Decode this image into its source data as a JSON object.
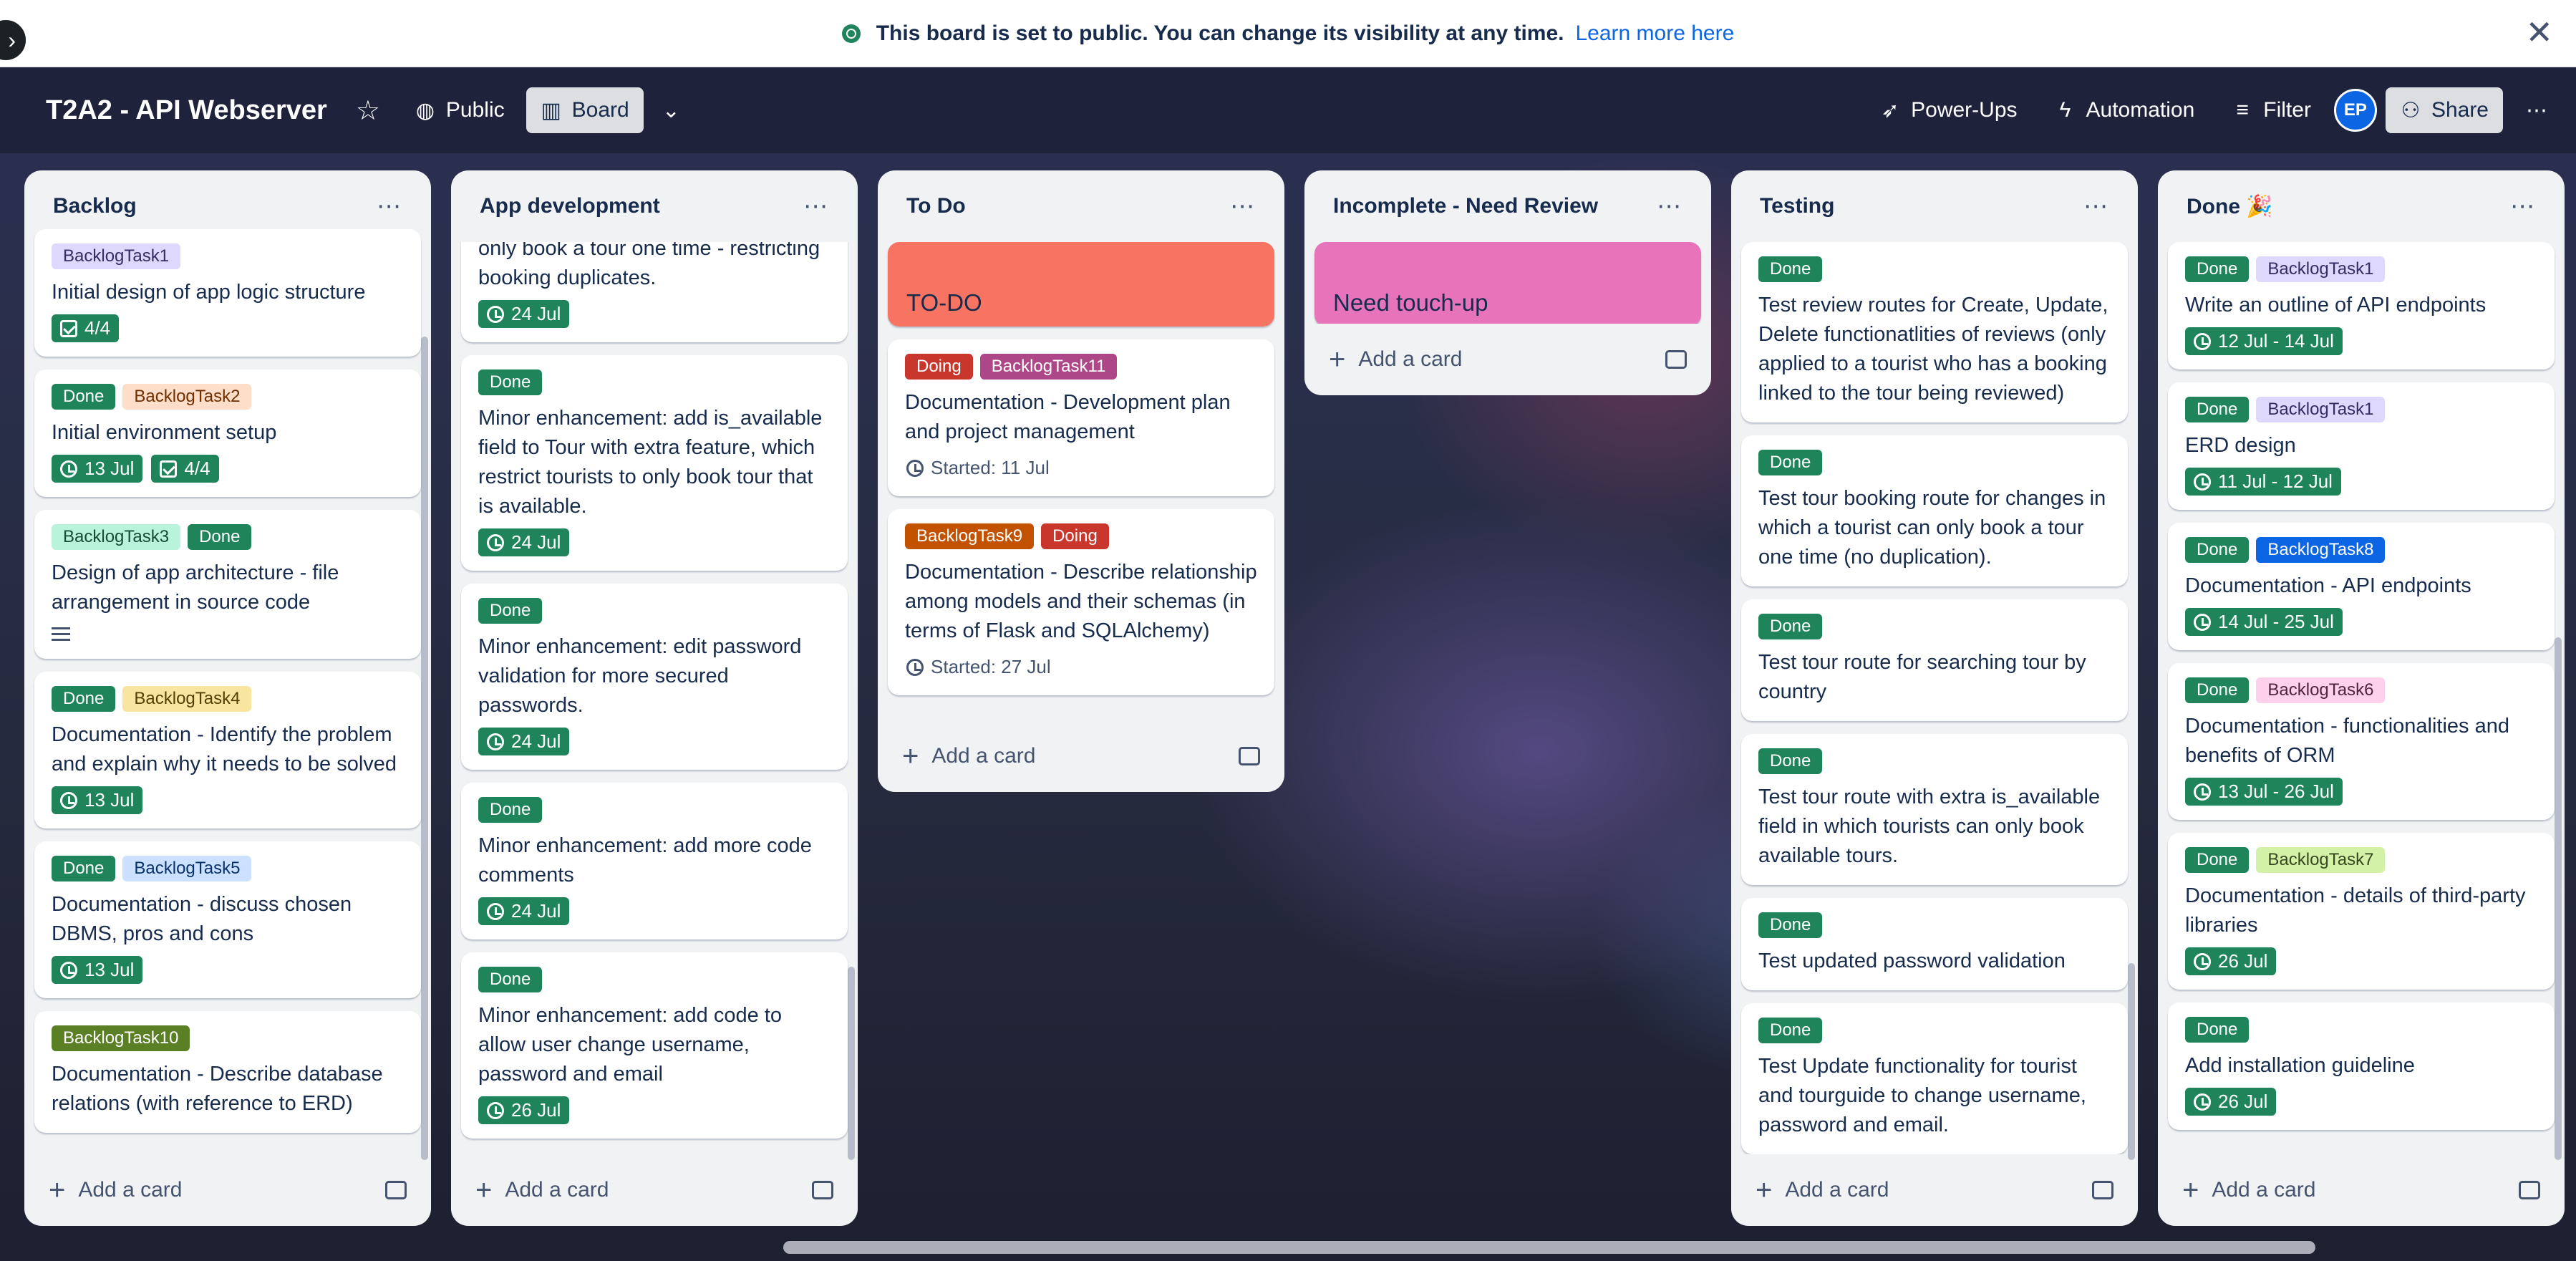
{
  "banner": {
    "message": "This board is set to public. You can change its visibility at any time.",
    "link": "Learn more here"
  },
  "board": {
    "title": "T2A2 - API Webserver",
    "visibility": "Public",
    "view": "Board",
    "power_ups": "Power-Ups",
    "automation": "Automation",
    "filter": "Filter",
    "avatar_initials": "EP",
    "share": "Share"
  },
  "lists": [
    {
      "title": "Backlog",
      "add_card": "Add a card",
      "cards": [
        {
          "labels": [
            {
              "text": "BacklogTask1",
              "bg": "#dfd8fd",
              "fg": "#352c63"
            }
          ],
          "title": "Initial design of app logic structure",
          "badges": [
            {
              "type": "check",
              "text": "4/4"
            }
          ]
        },
        {
          "labels": [
            {
              "text": "Done",
              "bg": "#1f845a",
              "fg": "#ffffff"
            },
            {
              "text": "BacklogTask2",
              "bg": "#fedec8",
              "fg": "#702e00"
            }
          ],
          "title": "Initial environment setup",
          "badges": [
            {
              "type": "date",
              "text": "13 Jul"
            },
            {
              "type": "check",
              "text": "4/4"
            }
          ]
        },
        {
          "labels": [
            {
              "text": "BacklogTask3",
              "bg": "#baf3db",
              "fg": "#164b35"
            },
            {
              "text": "Done",
              "bg": "#1f845a",
              "fg": "#ffffff"
            }
          ],
          "title": "Design of app architecture - file arrangement in source code",
          "description": true,
          "badges": []
        },
        {
          "labels": [
            {
              "text": "Done",
              "bg": "#1f845a",
              "fg": "#ffffff"
            },
            {
              "text": "BacklogTask4",
              "bg": "#f8e6a0",
              "fg": "#533f04"
            }
          ],
          "title": "Documentation - Identify the problem and explain why it needs to be solved",
          "badges": [
            {
              "type": "date",
              "text": "13 Jul"
            }
          ]
        },
        {
          "labels": [
            {
              "text": "Done",
              "bg": "#1f845a",
              "fg": "#ffffff"
            },
            {
              "text": "BacklogTask5",
              "bg": "#cce0ff",
              "fg": "#09326c"
            }
          ],
          "title": "Documentation - discuss chosen DBMS, pros and cons",
          "badges": [
            {
              "type": "date",
              "text": "13 Jul"
            }
          ]
        },
        {
          "labels": [
            {
              "text": "BacklogTask10",
              "bg": "#5b7f24",
              "fg": "#ffffff"
            }
          ],
          "title": "Documentation - Describe database relations (with reference to ERD)",
          "badges": []
        }
      ]
    },
    {
      "title": "App development",
      "add_card": "Add a card",
      "cards": [
        {
          "partial": true,
          "labels": [],
          "title": "Minor enhancement: one tourist can only book a tour one time - restricting booking duplicates.",
          "badges": [
            {
              "type": "date",
              "text": "24 Jul"
            }
          ]
        },
        {
          "labels": [
            {
              "text": "Done",
              "bg": "#1f845a",
              "fg": "#ffffff"
            }
          ],
          "title": "Minor enhancement: add is_available field to Tour with extra feature, which restrict tourists to only book tour that is available.",
          "badges": [
            {
              "type": "date",
              "text": "24 Jul"
            }
          ]
        },
        {
          "labels": [
            {
              "text": "Done",
              "bg": "#1f845a",
              "fg": "#ffffff"
            }
          ],
          "title": "Minor enhancement: edit password validation for more secured passwords.",
          "badges": [
            {
              "type": "date",
              "text": "24 Jul"
            }
          ]
        },
        {
          "labels": [
            {
              "text": "Done",
              "bg": "#1f845a",
              "fg": "#ffffff"
            }
          ],
          "title": "Minor enhancement: add more code comments",
          "badges": [
            {
              "type": "date",
              "text": "24 Jul"
            }
          ]
        },
        {
          "labels": [
            {
              "text": "Done",
              "bg": "#1f845a",
              "fg": "#ffffff"
            }
          ],
          "title": "Minor enhancement: add code to allow user change username, password and email",
          "badges": [
            {
              "type": "date",
              "text": "26 Jul"
            }
          ]
        }
      ]
    },
    {
      "title": "To Do",
      "add_card": "Add a card",
      "cards": [
        {
          "cover": true,
          "cover_color": "#f87462",
          "title": "TO-DO"
        },
        {
          "labels": [
            {
              "text": "Doing",
              "bg": "#c9372c",
              "fg": "#ffffff"
            },
            {
              "text": "BacklogTask11",
              "bg": "#ae4787",
              "fg": "#ffffff"
            }
          ],
          "title": "Documentation - Development plan and project management",
          "badges": [
            {
              "type": "started",
              "text": "Started: 11 Jul"
            }
          ]
        },
        {
          "labels": [
            {
              "text": "BacklogTask9",
              "bg": "#c25100",
              "fg": "#ffffff"
            },
            {
              "text": "Doing",
              "bg": "#c9372c",
              "fg": "#ffffff"
            }
          ],
          "title": "Documentation - Describe relationship among models and their schemas (in terms of Flask and SQLAlchemy)",
          "badges": [
            {
              "type": "started",
              "text": "Started: 27 Jul"
            }
          ]
        }
      ]
    },
    {
      "title": "Incomplete - Need Review",
      "add_card": "Add a card",
      "cards": [
        {
          "cover": true,
          "cover_color": "#e774bb",
          "title": "Need touch-up"
        }
      ]
    },
    {
      "title": "Testing",
      "add_card": "Add a card",
      "cards": [
        {
          "labels": [
            {
              "text": "Done",
              "bg": "#1f845a",
              "fg": "#ffffff"
            }
          ],
          "title": "Test review routes for Create, Update, Delete functionatlities of reviews (only applied to a tourist who has a booking linked to the tour being reviewed)",
          "badges": []
        },
        {
          "labels": [
            {
              "text": "Done",
              "bg": "#1f845a",
              "fg": "#ffffff"
            }
          ],
          "title": "Test tour booking route for changes in which a tourist can only book a tour one time (no duplication).",
          "badges": []
        },
        {
          "labels": [
            {
              "text": "Done",
              "bg": "#1f845a",
              "fg": "#ffffff"
            }
          ],
          "title": "Test tour route for searching tour by country",
          "badges": []
        },
        {
          "labels": [
            {
              "text": "Done",
              "bg": "#1f845a",
              "fg": "#ffffff"
            }
          ],
          "title": "Test tour route with extra is_available field in which tourists can only book available tours.",
          "badges": []
        },
        {
          "labels": [
            {
              "text": "Done",
              "bg": "#1f845a",
              "fg": "#ffffff"
            }
          ],
          "title": "Test updated password validation",
          "badges": []
        },
        {
          "labels": [
            {
              "text": "Done",
              "bg": "#1f845a",
              "fg": "#ffffff"
            }
          ],
          "title": "Test Update functionality for tourist and tourguide to change username, password and email.",
          "badges": []
        }
      ]
    },
    {
      "title": "Done 🎉",
      "add_card": "Add a card",
      "cards": [
        {
          "labels": [
            {
              "text": "Done",
              "bg": "#1f845a",
              "fg": "#ffffff"
            },
            {
              "text": "BacklogTask1",
              "bg": "#dfd8fd",
              "fg": "#352c63"
            }
          ],
          "title": "Write an outline of API endpoints",
          "badges": [
            {
              "type": "date",
              "text": "12 Jul - 14 Jul"
            }
          ]
        },
        {
          "labels": [
            {
              "text": "Done",
              "bg": "#1f845a",
              "fg": "#ffffff"
            },
            {
              "text": "BacklogTask1",
              "bg": "#dfd8fd",
              "fg": "#352c63"
            }
          ],
          "title": "ERD design",
          "badges": [
            {
              "type": "date",
              "text": "11 Jul - 12 Jul"
            }
          ]
        },
        {
          "labels": [
            {
              "text": "Done",
              "bg": "#1f845a",
              "fg": "#ffffff"
            },
            {
              "text": "BacklogTask8",
              "bg": "#0c66e4",
              "fg": "#ffffff"
            }
          ],
          "title": "Documentation - API endpoints",
          "badges": [
            {
              "type": "date",
              "text": "14 Jul - 25 Jul"
            }
          ]
        },
        {
          "labels": [
            {
              "text": "Done",
              "bg": "#1f845a",
              "fg": "#ffffff"
            },
            {
              "text": "BacklogTask6",
              "bg": "#fdd0ec",
              "fg": "#50253f"
            }
          ],
          "title": "Documentation - functionalities and benefits of ORM",
          "badges": [
            {
              "type": "date",
              "text": "13 Jul - 26 Jul"
            }
          ]
        },
        {
          "labels": [
            {
              "text": "Done",
              "bg": "#1f845a",
              "fg": "#ffffff"
            },
            {
              "text": "BacklogTask7",
              "bg": "#d3f1a7",
              "fg": "#37471f"
            }
          ],
          "title": "Documentation - details of third-party libraries",
          "badges": [
            {
              "type": "date",
              "text": "26 Jul"
            }
          ]
        },
        {
          "labels": [
            {
              "text": "Done",
              "bg": "#1f845a",
              "fg": "#ffffff"
            }
          ],
          "title": "Add installation guideline",
          "badges": [
            {
              "type": "date",
              "text": "26 Jul"
            }
          ]
        }
      ]
    }
  ]
}
